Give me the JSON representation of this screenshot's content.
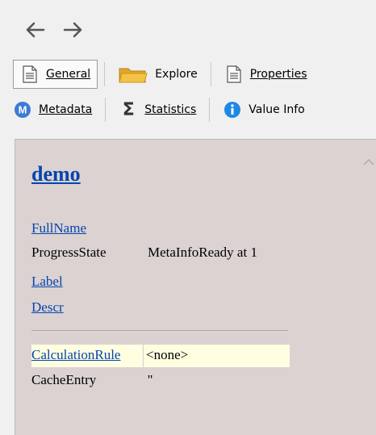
{
  "toolbar": {
    "general_label": "General",
    "explore_label": "Explore",
    "properties_label": "Properties",
    "metadata_label": "Metadata",
    "statistics_label": "Statistics",
    "valueinfo_label": "Value Info"
  },
  "icons": {
    "back": "arrow-left",
    "forward": "arrow-right",
    "general": "document-icon",
    "explore": "folder-icon",
    "properties": "document-icon",
    "metadata": "metadata-circle-icon",
    "statistics": "sigma-icon",
    "valueinfo": "info-icon"
  },
  "panel": {
    "title": "demo",
    "fullname_label": "FullName",
    "progress_label": "ProgressState",
    "progress_value": "MetaInfoReady at 1",
    "label_label": "Label",
    "descr_label": "Descr",
    "calc_label": "CalculationRule",
    "calc_value": "<none>",
    "cache_label": "CacheEntry",
    "cache_value": "''"
  },
  "colors": {
    "panel_bg": "#dcd2d2",
    "link": "#0645ad",
    "highlight": "#fffee0",
    "metadata_badge": "#3b7bd6",
    "info_badge": "#1e88e5"
  }
}
